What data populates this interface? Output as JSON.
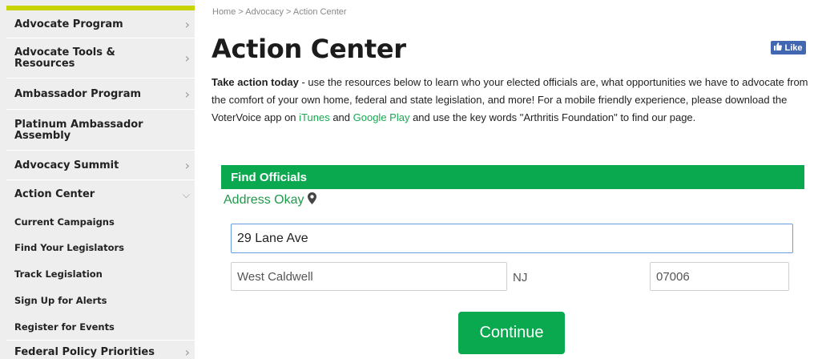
{
  "sidebar": {
    "items": [
      {
        "label": "Advocate Program"
      },
      {
        "label": "Advocate Tools & Resources"
      },
      {
        "label": "Ambassador Program"
      },
      {
        "label": "Platinum Ambassador Assembly"
      },
      {
        "label": "Advocacy Summit"
      },
      {
        "label": "Action Center"
      },
      {
        "label": "Federal Policy Priorities"
      }
    ],
    "subitems": [
      {
        "label": "Current Campaigns"
      },
      {
        "label": "Find Your Legislators"
      },
      {
        "label": "Track Legislation"
      },
      {
        "label": "Sign Up for Alerts"
      },
      {
        "label": "Register for Events"
      }
    ]
  },
  "breadcrumb": "Home > Advocacy > Action Center",
  "title": "Action Center",
  "like_label": "Like",
  "intro": {
    "lead": "Take action today",
    "text1": " - use the resources below to learn who your elected officials are, what opportunities we have to advocate from the comfort of your own home, federal and state legislation, and more! For a mobile friendly experience, please download the VoterVoice app on ",
    "link1": "iTunes",
    "text2": " and ",
    "link2": "Google Play",
    "text3": " and use the key words \"Arthritis Foundation\" to find our page."
  },
  "form": {
    "header": "Find Officials",
    "status": "Address Okay",
    "street": "29 Lane Ave",
    "city": "West Caldwell",
    "state": "NJ",
    "zip": "07006",
    "continue": "Continue"
  },
  "colors": {
    "accent": "#0aa84f",
    "sidebar_top": "#c8d400",
    "facebook": "#4267b2"
  }
}
